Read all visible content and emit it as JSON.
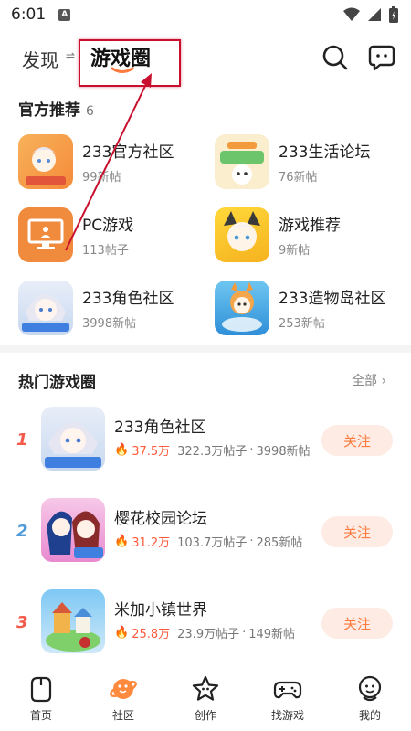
{
  "status_bar": {
    "time": "6:01",
    "notification_icon": "A"
  },
  "header": {
    "tab_discover": "发现",
    "swap_symbol": "⇌",
    "tab_game_circle": "游戏圈"
  },
  "official": {
    "title": "官方推荐",
    "count": "6",
    "items": [
      {
        "name": "233官方社区",
        "sub": "99新帖"
      },
      {
        "name": "233生活论坛",
        "sub": "76新帖"
      },
      {
        "name": "PC游戏",
        "sub": "113帖子"
      },
      {
        "name": "游戏推荐",
        "sub": "9新帖"
      },
      {
        "name": "233角色社区",
        "sub": "3998新帖"
      },
      {
        "name": "233造物岛社区",
        "sub": "253新帖"
      }
    ]
  },
  "hot": {
    "title": "热门游戏圈",
    "see_all": "全部 ›",
    "rows": [
      {
        "rank": "1",
        "name": "233角色社区",
        "heat": "37.5万",
        "posts": "322.3万帖子",
        "new_posts": "3998新帖",
        "follow": "关注",
        "rank_color": "#f25a4a"
      },
      {
        "rank": "2",
        "name": "樱花校园论坛",
        "heat": "31.2万",
        "posts": "103.7万帖子",
        "new_posts": "285新帖",
        "follow": "关注",
        "rank_color": "#4f9ad8"
      },
      {
        "rank": "3",
        "name": "米加小镇世界",
        "heat": "25.8万",
        "posts": "23.9万帖子",
        "new_posts": "149新帖",
        "follow": "关注",
        "rank_color": "#f25a4a"
      }
    ]
  },
  "bottom_nav": [
    {
      "label": "首页",
      "icon": "home-icon"
    },
    {
      "label": "社区",
      "icon": "planet-icon",
      "active": true
    },
    {
      "label": "创作",
      "icon": "star-icon"
    },
    {
      "label": "找游戏",
      "icon": "gamepad-icon"
    },
    {
      "label": "我的",
      "icon": "profile-icon"
    }
  ],
  "colors": {
    "accent": "#ff7a3d",
    "follow_bg": "#fdebe4",
    "annotation": "#c8102e"
  }
}
